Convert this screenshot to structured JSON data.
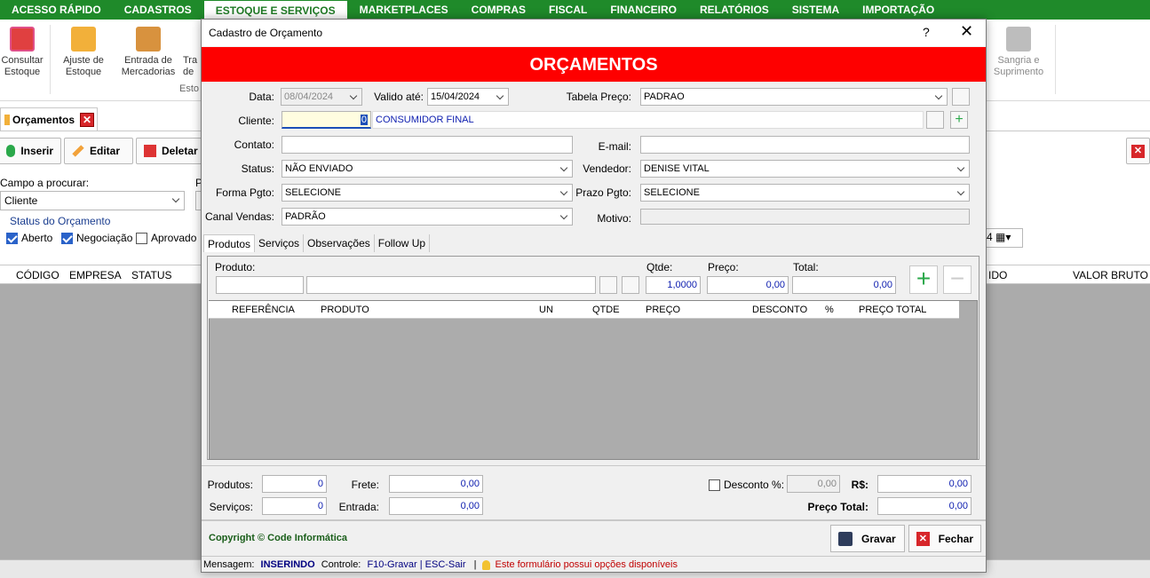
{
  "menu": [
    "ACESSO RÁPIDO",
    "CADASTROS",
    "ESTOQUE E SERVIÇOS",
    "MARKETPLACES",
    "COMPRAS",
    "FISCAL",
    "FINANCEIRO",
    "RELATÓRIOS",
    "SISTEMA",
    "IMPORTAÇÃO"
  ],
  "ribbon": {
    "consultar": [
      "Consultar",
      "Estoque"
    ],
    "ajuste": [
      "Ajuste de",
      "Estoque"
    ],
    "entrada": [
      "Entrada de",
      "Mercadorias"
    ],
    "tra": [
      "Tra",
      "de"
    ],
    "group_label": "Esto",
    "sangria": [
      "Sangria e",
      "Suprimento"
    ]
  },
  "background": {
    "doc_tab": "Orçamentos",
    "btn_inserir": "Inserir",
    "btn_editar": "Editar",
    "btn_deletar": "Deletar",
    "campo_label": "Campo a procurar:",
    "campo_value": "Cliente",
    "p_label": "P",
    "status_group": "Status do Orçamento",
    "status_aberto": "Aberto",
    "status_negociacao": "Negociação",
    "status_aprovado": "Aprovado",
    "date_tail": "4",
    "columns": [
      "CÓDIGO",
      "EMPRESA",
      "STATUS",
      "IDO",
      "VALOR BRUTO"
    ]
  },
  "modal": {
    "title": "Cadastro de Orçamento",
    "help": "?",
    "close": "✕",
    "banner": "ORÇAMENTOS",
    "data_label": "Data:",
    "data_value": "08/04/2024",
    "valido_label": "Valido até:",
    "valido_value": "15/04/2024",
    "tabela_label": "Tabela Preço:",
    "tabela_value": "PADRAO",
    "cliente_label": "Cliente:",
    "cliente_code": "0",
    "cliente_name": "CONSUMIDOR FINAL",
    "contato_label": "Contato:",
    "contato_value": "",
    "email_label": "E-mail:",
    "email_value": "",
    "status_label": "Status:",
    "status_value": "NÃO ENVIADO",
    "vendedor_label": "Vendedor:",
    "vendedor_value": "DENISE VITAL",
    "forma_label": "Forma Pgto:",
    "forma_value": "SELECIONE",
    "prazo_label": "Prazo Pgto:",
    "prazo_value": "SELECIONE",
    "canal_label": "Canal Vendas:",
    "canal_value": "PADRÃO",
    "motivo_label": "Motivo:",
    "motivo_value": "",
    "tabs": [
      "Produtos",
      "Serviços",
      "Observações",
      "Follow Up"
    ],
    "produto_label": "Produto:",
    "qtde_label": "Qtde:",
    "qtde_value": "1,0000",
    "preco_label": "Preço:",
    "preco_value": "0,00",
    "total_label": "Total:",
    "total_value": "0,00",
    "item_columns": [
      "REFERÊNCIA",
      "PRODUTO",
      "UN",
      "QTDE",
      "PREÇO",
      "DESCONTO",
      "%",
      "PREÇO TOTAL"
    ],
    "totals": {
      "produtos_label": "Produtos:",
      "produtos_value": "0",
      "servicos_label": "Serviços:",
      "servicos_value": "0",
      "frete_label": "Frete:",
      "frete_value": "0,00",
      "entrada_label": "Entrada:",
      "entrada_value": "0,00",
      "desconto_label": "Desconto %:",
      "desconto_value": "0,00",
      "rs_label": "R$:",
      "rs_value": "0,00",
      "preco_total_label": "Preço Total:",
      "preco_total_value": "0,00"
    },
    "copyright": "Copyright © Code Informática",
    "btn_gravar": "Gravar",
    "btn_fechar": "Fechar",
    "status_bar": {
      "mensagem_label": "Mensagem:",
      "mensagem_value": "INSERINDO",
      "controle_label": "Controle:",
      "controle_value": "F10-Gravar | ESC-Sair",
      "sep": "|",
      "hint": "Este formulário possui opções disponíveis"
    }
  },
  "colors": {
    "menu_green": "#1f8a2a",
    "banner_red": "#fe0000",
    "value_blue": "#1020b0"
  }
}
